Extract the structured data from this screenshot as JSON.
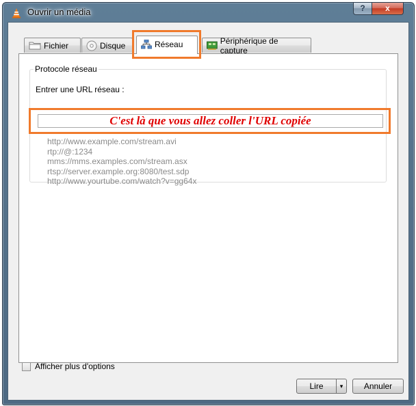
{
  "window": {
    "title": "Ouvrir un média",
    "help_label": "?",
    "close_label": "x"
  },
  "tabs": [
    {
      "label": "Fichier",
      "icon": "folder-icon"
    },
    {
      "label": "Disque",
      "icon": "disc-icon"
    },
    {
      "label": "Réseau",
      "icon": "network-icon",
      "active": true
    },
    {
      "label": "Périphérique de capture",
      "icon": "capture-card-icon"
    }
  ],
  "network": {
    "group_title": "Protocole réseau",
    "url_label": "Entrer une URL réseau :",
    "url_value": "C'est là que vous allez coller l'URL copiée",
    "examples": [
      "http://www.example.com/stream.avi",
      "rtp://@:1234",
      "mms://mms.examples.com/stream.asx",
      "rtsp://server.example.org:8080/test.sdp",
      "http://www.yourtube.com/watch?v=gg64x"
    ]
  },
  "footer": {
    "more_options_label": "Afficher plus d'options",
    "more_options_checked": false,
    "play_label": "Lire",
    "dropdown_glyph": "▾",
    "cancel_label": "Annuler"
  },
  "colors": {
    "highlight": "#f07a2c",
    "annotation_text": "#e00000"
  }
}
